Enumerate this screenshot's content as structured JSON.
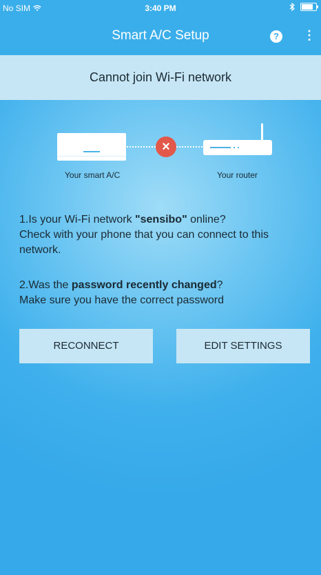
{
  "status_bar": {
    "carrier": "No SIM",
    "time": "3:40 PM"
  },
  "header": {
    "title": "Smart A/C Setup",
    "help_label": "?",
    "more_label": "⋮"
  },
  "banner": {
    "text": "Cannot join Wi-Fi network"
  },
  "diagram": {
    "ac_label": "Your smart A/C",
    "router_label": "Your router",
    "error_glyph": "×"
  },
  "instructions": {
    "item1_prefix": "1.Is your Wi-Fi network ",
    "item1_network": "\"sensibo\"",
    "item1_suffix": " online?",
    "item1_line2": "Check with your phone that you can connect to this network.",
    "item2_prefix": "2.Was the ",
    "item2_bold": "password recently changed",
    "item2_suffix": "?",
    "item2_line2": "Make sure you have the correct password"
  },
  "buttons": {
    "reconnect": "RECONNECT",
    "edit_settings": "EDIT SETTINGS"
  },
  "colors": {
    "header_bg": "#3aaeea",
    "banner_bg": "#c7e6f5",
    "error_red": "#e2584a"
  }
}
